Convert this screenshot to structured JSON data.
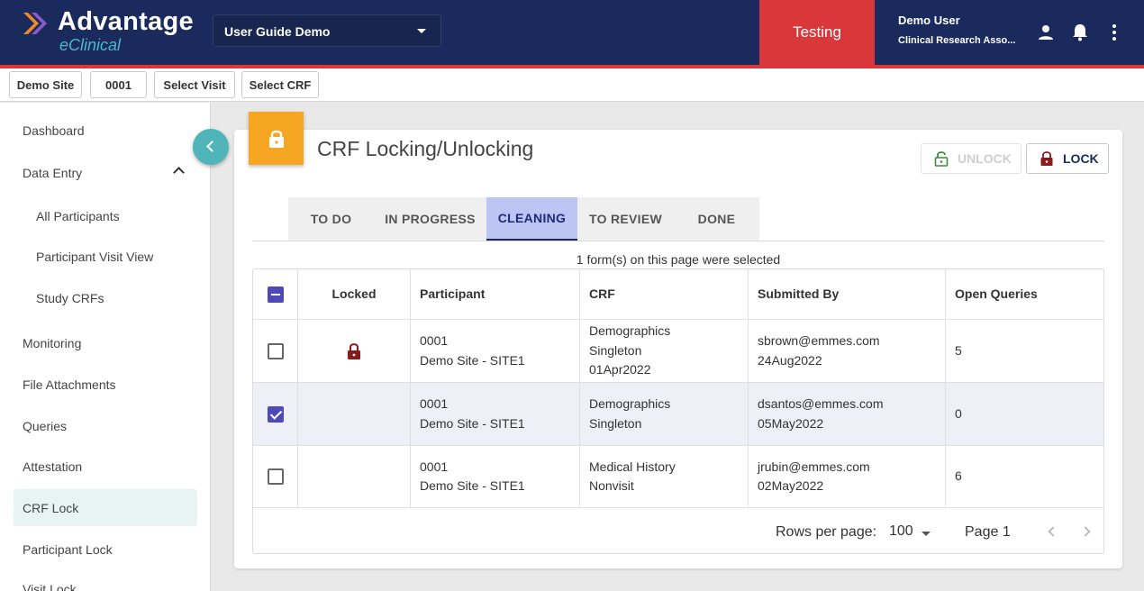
{
  "header": {
    "brand": "Advantage",
    "brand_sub": "eClinical",
    "study_select": "User Guide Demo",
    "environment": "Testing",
    "user_name": "Demo User",
    "user_role": "Clinical Research Asso..."
  },
  "context_bar": {
    "site": "Demo Site",
    "participant": "0001",
    "visit": "Select Visit",
    "crf": "Select CRF"
  },
  "sidebar": {
    "items": [
      {
        "label": "Dashboard"
      },
      {
        "label": "Data Entry"
      },
      {
        "label": "All Participants"
      },
      {
        "label": "Participant Visit View"
      },
      {
        "label": "Study CRFs"
      },
      {
        "label": "Monitoring"
      },
      {
        "label": "File Attachments"
      },
      {
        "label": "Queries"
      },
      {
        "label": "Attestation"
      },
      {
        "label": "CRF Lock"
      },
      {
        "label": "Participant Lock"
      },
      {
        "label": "Visit Lock"
      }
    ]
  },
  "page": {
    "title": "CRF Locking/Unlocking",
    "unlock_label": "UNLOCK",
    "lock_label": "LOCK",
    "tabs": [
      {
        "label": "TO DO"
      },
      {
        "label": "IN PROGRESS"
      },
      {
        "label": "CLEANING"
      },
      {
        "label": "TO REVIEW"
      },
      {
        "label": "DONE"
      }
    ],
    "selection_info": "1 form(s) on this page were selected"
  },
  "table": {
    "columns": [
      "Locked",
      "Participant",
      "CRF",
      "Submitted By",
      "Open Queries"
    ],
    "rows": [
      {
        "participant_id": "0001",
        "participant_site": "Demo Site - SITE1",
        "crf_name": "Demographics",
        "crf_type": "Singleton",
        "crf_date": "01Apr2022",
        "submitted_by": "sbrown@emmes.com",
        "submitted_date": "24Aug2022",
        "open_queries": "5"
      },
      {
        "participant_id": "0001",
        "participant_site": "Demo Site - SITE1",
        "crf_name": "Demographics",
        "crf_type": "Singleton",
        "submitted_by": "dsantos@emmes.com",
        "submitted_date": "05May2022",
        "open_queries": "0"
      },
      {
        "participant_id": "0001",
        "participant_site": "Demo Site - SITE1",
        "crf_name": "Medical History",
        "crf_type": "Nonvisit",
        "submitted_by": "jrubin@emmes.com",
        "submitted_date": "02May2022",
        "open_queries": "6"
      }
    ]
  },
  "pagination": {
    "rows_per_page_label": "Rows per page:",
    "rows_per_page": "100",
    "page_label": "Page 1"
  },
  "colors": {
    "header_bg": "#1a2a5c",
    "env_red": "#d9373a",
    "accent_teal": "#4fb5b8",
    "lock_orange": "#f6a623",
    "lock_red": "#8b1a1a",
    "unlock_green": "#3a8a3a",
    "checkbox_purple": "#4d4ab8",
    "active_tab": "#bcc5f4"
  }
}
